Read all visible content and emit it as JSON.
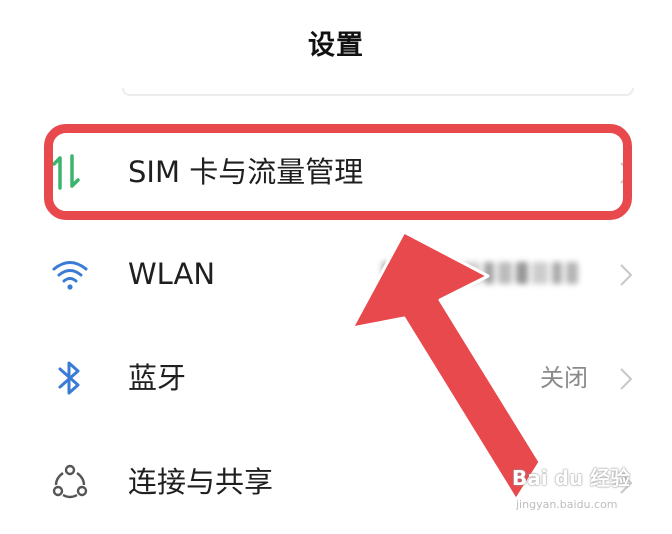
{
  "header": {
    "title": "设置"
  },
  "rows": [
    {
      "label": "SIM 卡与流量管理",
      "value": "",
      "icon": "sim-data-arrows-icon"
    },
    {
      "label": "WLAN",
      "value": "",
      "icon": "wifi-icon"
    },
    {
      "label": "蓝牙",
      "value": "关闭",
      "icon": "bluetooth-icon"
    },
    {
      "label": "连接与共享",
      "value": "",
      "icon": "connection-share-icon"
    }
  ],
  "colors": {
    "highlight": "#e8494c",
    "icon_green": "#3bb56b",
    "icon_blue": "#3a7bd5",
    "chevron": "#c8c8c8"
  },
  "watermark": {
    "brand": "Bai du 经验",
    "url": "jingyan.baidu.com"
  }
}
